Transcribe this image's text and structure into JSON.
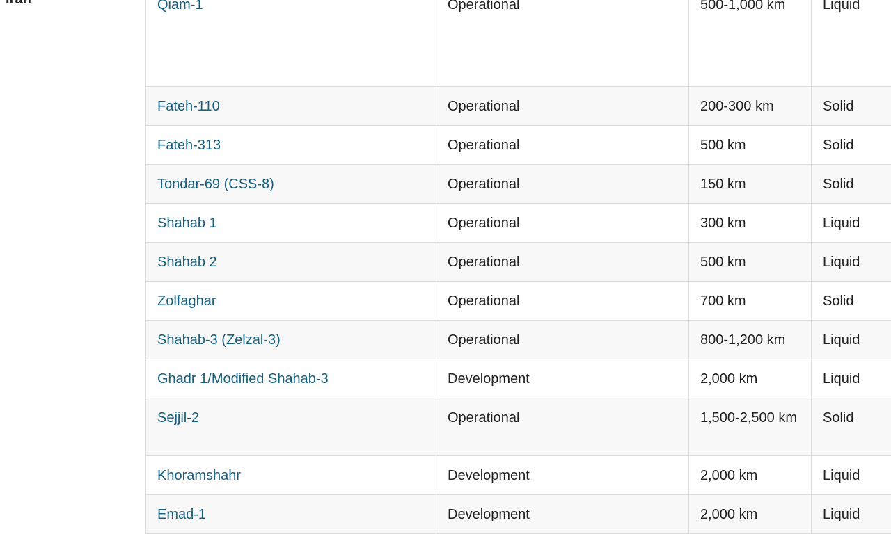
{
  "country": "Iran",
  "rows": [
    {
      "name": "Qiam-1",
      "status": "Operational",
      "range": "500-1,000 km",
      "propellant": "Liquid"
    },
    {
      "name": "Fateh-110",
      "status": "Operational",
      "range": "200-300 km",
      "propellant": "Solid"
    },
    {
      "name": "Fateh-313",
      "status": "Operational",
      "range": "500 km",
      "propellant": "Solid"
    },
    {
      "name": "Tondar-69 (CSS-8)",
      "status": "Operational",
      "range": "150 km",
      "propellant": "Solid"
    },
    {
      "name": "Shahab 1",
      "status": "Operational",
      "range": "300 km",
      "propellant": "Liquid"
    },
    {
      "name": "Shahab 2",
      "status": "Operational",
      "range": "500 km",
      "propellant": "Liquid"
    },
    {
      "name": "Zolfaghar",
      "status": "Operational",
      "range": "700 km",
      "propellant": "Solid"
    },
    {
      "name": "Shahab-3 (Zelzal-3)",
      "status": "Operational",
      "range": "800-1,200 km",
      "propellant": "Liquid"
    },
    {
      "name": "Ghadr 1/Modified Shahab-3",
      "status": "Development",
      "range": "2,000 km",
      "propellant": "Liquid"
    },
    {
      "name": "Sejjil-2",
      "status": "Operational",
      "range": "1,500-2,500 km",
      "propellant": "Solid"
    },
    {
      "name": "Khoramshahr",
      "status": "Development",
      "range": "2,000 km",
      "propellant": "Liquid"
    },
    {
      "name": "Emad-1",
      "status": "Development",
      "range": "2,000 km",
      "propellant": "Liquid"
    }
  ]
}
